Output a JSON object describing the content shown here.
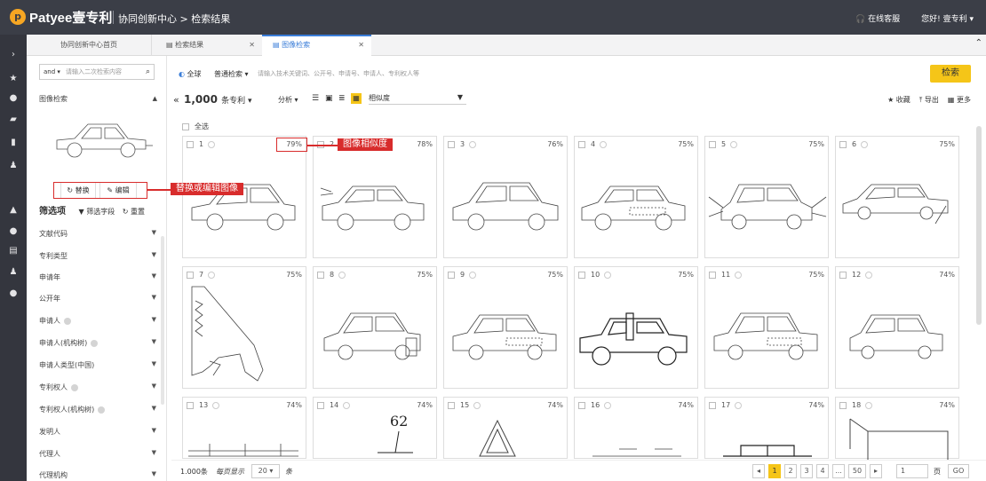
{
  "topbar": {
    "logo_letter": "p",
    "brand": "Patyee壹专利",
    "crumb": "协同创新中心 > 检索结果",
    "support": "在线客服",
    "greeting": "您好! 壹专利 ▾"
  },
  "tabs": [
    {
      "label": "协同创新中心首页"
    },
    {
      "label": "检索结果"
    },
    {
      "label": "图像检索"
    }
  ],
  "sidebar": {
    "search_mode": "and ▾",
    "search_placeholder": "请输入二次检索内容",
    "image_search_title": "图像检索",
    "replace_label": "替换",
    "edit_label": "编辑",
    "filter_title": "筛选项",
    "filter_field": "筛选字段",
    "filter_reset": "重置",
    "filters": [
      "文献代码",
      "专利类型",
      "申请年",
      "公开年",
      "申请人",
      "申请人(机构树)",
      "申请人类型(中国)",
      "专利权人",
      "专利权人(机构树)",
      "发明人",
      "代理人",
      "代理机构"
    ]
  },
  "search": {
    "globe": "全球",
    "scope": "普通检索 ▾",
    "placeholder": "请输入技术关键词、公开号、申请号、申请人、专利权人等",
    "button": "检索"
  },
  "toolbar": {
    "count": "1,000",
    "count_unit": "条专利 ▾",
    "analysis": "分析 ▾",
    "sort": "相似度",
    "favorite": "收藏",
    "export": "导出",
    "more": "更多",
    "select_all": "全选"
  },
  "results": [
    {
      "n": "1",
      "pct": "79%"
    },
    {
      "n": "2",
      "pct": "78%"
    },
    {
      "n": "3",
      "pct": "76%"
    },
    {
      "n": "4",
      "pct": "75%"
    },
    {
      "n": "5",
      "pct": "75%"
    },
    {
      "n": "6",
      "pct": "75%"
    },
    {
      "n": "7",
      "pct": "75%"
    },
    {
      "n": "8",
      "pct": "75%"
    },
    {
      "n": "9",
      "pct": "75%"
    },
    {
      "n": "10",
      "pct": "75%"
    },
    {
      "n": "11",
      "pct": "75%"
    },
    {
      "n": "12",
      "pct": "74%"
    },
    {
      "n": "13",
      "pct": "74%"
    },
    {
      "n": "14",
      "pct": "74%"
    },
    {
      "n": "15",
      "pct": "74%"
    },
    {
      "n": "16",
      "pct": "74%"
    },
    {
      "n": "17",
      "pct": "74%"
    },
    {
      "n": "18",
      "pct": "74%"
    }
  ],
  "card14_number": "62",
  "annotations": {
    "similarity": "图像相似度",
    "replace_edit": "替换或编辑图像"
  },
  "pagination": {
    "total": "1.000条",
    "per_page_label": "每页显示",
    "per_page": "20 ▾",
    "unit": "条",
    "pages": [
      "1",
      "2",
      "3",
      "4",
      "...",
      "50"
    ],
    "current_input": "1",
    "page_label": "页",
    "go": "GO"
  },
  "colors": {
    "accent": "#f5c518",
    "topbar": "#3b3e47",
    "annotation": "#d82c2c",
    "active_tab": "#3a7dd8"
  }
}
